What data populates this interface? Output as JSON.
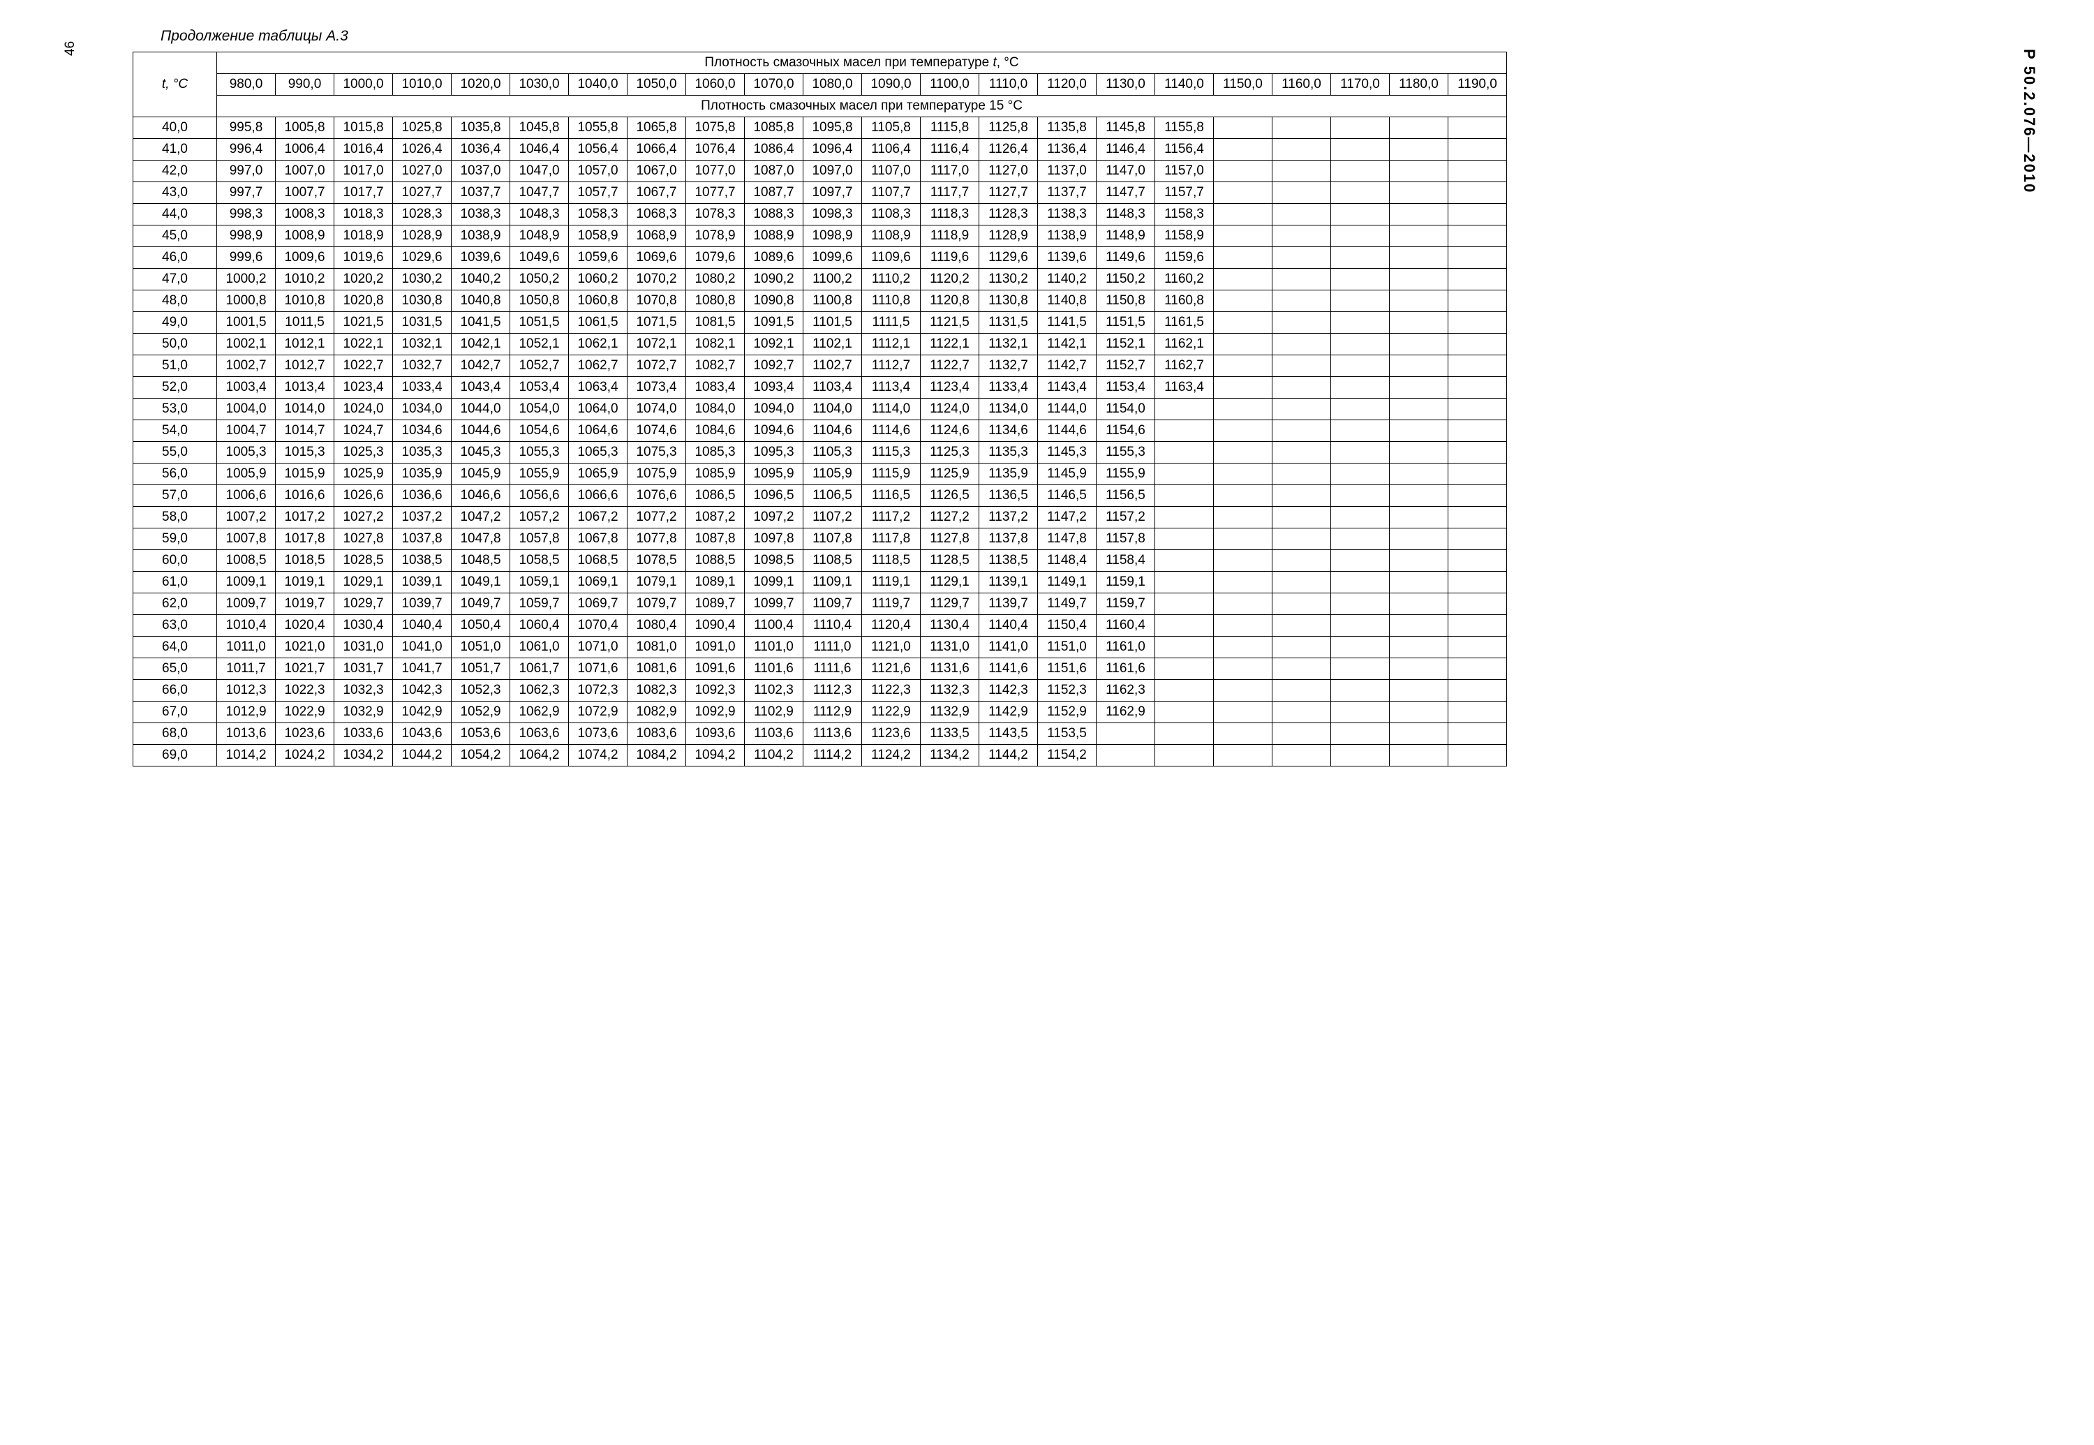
{
  "page_number": "46",
  "caption": "Продолжение таблицы А.3",
  "side_label": "Р 50.2.076—2010",
  "header": {
    "row_label": "t, °C",
    "span1_prefix": "Плотность смазочных масел при температуре ",
    "span1_var": "t",
    "span1_suffix": ", °C",
    "span2": "Плотность смазочных масел при температуре 15 °C",
    "cols": [
      "980,0",
      "990,0",
      "1000,0",
      "1010,0",
      "1020,0",
      "1030,0",
      "1040,0",
      "1050,0",
      "1060,0",
      "1070,0",
      "1080,0",
      "1090,0",
      "1100,0",
      "1110,0",
      "1120,0",
      "1130,0",
      "1140,0",
      "1150,0",
      "1160,0",
      "1170,0",
      "1180,0",
      "1190,0"
    ]
  },
  "rows": [
    {
      "t": "40,0",
      "v": [
        "995,8",
        "1005,8",
        "1015,8",
        "1025,8",
        "1035,8",
        "1045,8",
        "1055,8",
        "1065,8",
        "1075,8",
        "1085,8",
        "1095,8",
        "1105,8",
        "1115,8",
        "1125,8",
        "1135,8",
        "1145,8",
        "1155,8",
        "",
        "",
        "",
        "",
        ""
      ]
    },
    {
      "t": "41,0",
      "v": [
        "996,4",
        "1006,4",
        "1016,4",
        "1026,4",
        "1036,4",
        "1046,4",
        "1056,4",
        "1066,4",
        "1076,4",
        "1086,4",
        "1096,4",
        "1106,4",
        "1116,4",
        "1126,4",
        "1136,4",
        "1146,4",
        "1156,4",
        "",
        "",
        "",
        "",
        ""
      ]
    },
    {
      "t": "42,0",
      "v": [
        "997,0",
        "1007,0",
        "1017,0",
        "1027,0",
        "1037,0",
        "1047,0",
        "1057,0",
        "1067,0",
        "1077,0",
        "1087,0",
        "1097,0",
        "1107,0",
        "1117,0",
        "1127,0",
        "1137,0",
        "1147,0",
        "1157,0",
        "",
        "",
        "",
        "",
        ""
      ]
    },
    {
      "t": "43,0",
      "v": [
        "997,7",
        "1007,7",
        "1017,7",
        "1027,7",
        "1037,7",
        "1047,7",
        "1057,7",
        "1067,7",
        "1077,7",
        "1087,7",
        "1097,7",
        "1107,7",
        "1117,7",
        "1127,7",
        "1137,7",
        "1147,7",
        "1157,7",
        "",
        "",
        "",
        "",
        ""
      ]
    },
    {
      "t": "44,0",
      "v": [
        "998,3",
        "1008,3",
        "1018,3",
        "1028,3",
        "1038,3",
        "1048,3",
        "1058,3",
        "1068,3",
        "1078,3",
        "1088,3",
        "1098,3",
        "1108,3",
        "1118,3",
        "1128,3",
        "1138,3",
        "1148,3",
        "1158,3",
        "",
        "",
        "",
        "",
        ""
      ]
    },
    {
      "t": "45,0",
      "v": [
        "998,9",
        "1008,9",
        "1018,9",
        "1028,9",
        "1038,9",
        "1048,9",
        "1058,9",
        "1068,9",
        "1078,9",
        "1088,9",
        "1098,9",
        "1108,9",
        "1118,9",
        "1128,9",
        "1138,9",
        "1148,9",
        "1158,9",
        "",
        "",
        "",
        "",
        ""
      ]
    },
    {
      "t": "46,0",
      "v": [
        "999,6",
        "1009,6",
        "1019,6",
        "1029,6",
        "1039,6",
        "1049,6",
        "1059,6",
        "1069,6",
        "1079,6",
        "1089,6",
        "1099,6",
        "1109,6",
        "1119,6",
        "1129,6",
        "1139,6",
        "1149,6",
        "1159,6",
        "",
        "",
        "",
        "",
        ""
      ]
    },
    {
      "t": "47,0",
      "v": [
        "1000,2",
        "1010,2",
        "1020,2",
        "1030,2",
        "1040,2",
        "1050,2",
        "1060,2",
        "1070,2",
        "1080,2",
        "1090,2",
        "1100,2",
        "1110,2",
        "1120,2",
        "1130,2",
        "1140,2",
        "1150,2",
        "1160,2",
        "",
        "",
        "",
        "",
        ""
      ]
    },
    {
      "t": "48,0",
      "v": [
        "1000,8",
        "1010,8",
        "1020,8",
        "1030,8",
        "1040,8",
        "1050,8",
        "1060,8",
        "1070,8",
        "1080,8",
        "1090,8",
        "1100,8",
        "1110,8",
        "1120,8",
        "1130,8",
        "1140,8",
        "1150,8",
        "1160,8",
        "",
        "",
        "",
        "",
        ""
      ]
    },
    {
      "t": "49,0",
      "v": [
        "1001,5",
        "1011,5",
        "1021,5",
        "1031,5",
        "1041,5",
        "1051,5",
        "1061,5",
        "1071,5",
        "1081,5",
        "1091,5",
        "1101,5",
        "1111,5",
        "1121,5",
        "1131,5",
        "1141,5",
        "1151,5",
        "1161,5",
        "",
        "",
        "",
        "",
        ""
      ]
    },
    {
      "t": "50,0",
      "v": [
        "1002,1",
        "1012,1",
        "1022,1",
        "1032,1",
        "1042,1",
        "1052,1",
        "1062,1",
        "1072,1",
        "1082,1",
        "1092,1",
        "1102,1",
        "1112,1",
        "1122,1",
        "1132,1",
        "1142,1",
        "1152,1",
        "1162,1",
        "",
        "",
        "",
        "",
        ""
      ]
    },
    {
      "t": "51,0",
      "v": [
        "1002,7",
        "1012,7",
        "1022,7",
        "1032,7",
        "1042,7",
        "1052,7",
        "1062,7",
        "1072,7",
        "1082,7",
        "1092,7",
        "1102,7",
        "1112,7",
        "1122,7",
        "1132,7",
        "1142,7",
        "1152,7",
        "1162,7",
        "",
        "",
        "",
        "",
        ""
      ]
    },
    {
      "t": "52,0",
      "v": [
        "1003,4",
        "1013,4",
        "1023,4",
        "1033,4",
        "1043,4",
        "1053,4",
        "1063,4",
        "1073,4",
        "1083,4",
        "1093,4",
        "1103,4",
        "1113,4",
        "1123,4",
        "1133,4",
        "1143,4",
        "1153,4",
        "1163,4",
        "",
        "",
        "",
        "",
        ""
      ]
    },
    {
      "t": "53,0",
      "v": [
        "1004,0",
        "1014,0",
        "1024,0",
        "1034,0",
        "1044,0",
        "1054,0",
        "1064,0",
        "1074,0",
        "1084,0",
        "1094,0",
        "1104,0",
        "1114,0",
        "1124,0",
        "1134,0",
        "1144,0",
        "1154,0",
        "",
        "",
        "",
        "",
        "",
        ""
      ]
    },
    {
      "t": "54,0",
      "v": [
        "1004,7",
        "1014,7",
        "1024,7",
        "1034,6",
        "1044,6",
        "1054,6",
        "1064,6",
        "1074,6",
        "1084,6",
        "1094,6",
        "1104,6",
        "1114,6",
        "1124,6",
        "1134,6",
        "1144,6",
        "1154,6",
        "",
        "",
        "",
        "",
        "",
        ""
      ]
    },
    {
      "t": "55,0",
      "v": [
        "1005,3",
        "1015,3",
        "1025,3",
        "1035,3",
        "1045,3",
        "1055,3",
        "1065,3",
        "1075,3",
        "1085,3",
        "1095,3",
        "1105,3",
        "1115,3",
        "1125,3",
        "1135,3",
        "1145,3",
        "1155,3",
        "",
        "",
        "",
        "",
        "",
        ""
      ]
    },
    {
      "t": "56,0",
      "v": [
        "1005,9",
        "1015,9",
        "1025,9",
        "1035,9",
        "1045,9",
        "1055,9",
        "1065,9",
        "1075,9",
        "1085,9",
        "1095,9",
        "1105,9",
        "1115,9",
        "1125,9",
        "1135,9",
        "1145,9",
        "1155,9",
        "",
        "",
        "",
        "",
        "",
        ""
      ]
    },
    {
      "t": "57,0",
      "v": [
        "1006,6",
        "1016,6",
        "1026,6",
        "1036,6",
        "1046,6",
        "1056,6",
        "1066,6",
        "1076,6",
        "1086,5",
        "1096,5",
        "1106,5",
        "1116,5",
        "1126,5",
        "1136,5",
        "1146,5",
        "1156,5",
        "",
        "",
        "",
        "",
        "",
        ""
      ]
    },
    {
      "t": "58,0",
      "v": [
        "1007,2",
        "1017,2",
        "1027,2",
        "1037,2",
        "1047,2",
        "1057,2",
        "1067,2",
        "1077,2",
        "1087,2",
        "1097,2",
        "1107,2",
        "1117,2",
        "1127,2",
        "1137,2",
        "1147,2",
        "1157,2",
        "",
        "",
        "",
        "",
        "",
        ""
      ]
    },
    {
      "t": "59,0",
      "v": [
        "1007,8",
        "1017,8",
        "1027,8",
        "1037,8",
        "1047,8",
        "1057,8",
        "1067,8",
        "1077,8",
        "1087,8",
        "1097,8",
        "1107,8",
        "1117,8",
        "1127,8",
        "1137,8",
        "1147,8",
        "1157,8",
        "",
        "",
        "",
        "",
        "",
        ""
      ]
    },
    {
      "t": "60,0",
      "v": [
        "1008,5",
        "1018,5",
        "1028,5",
        "1038,5",
        "1048,5",
        "1058,5",
        "1068,5",
        "1078,5",
        "1088,5",
        "1098,5",
        "1108,5",
        "1118,5",
        "1128,5",
        "1138,5",
        "1148,4",
        "1158,4",
        "",
        "",
        "",
        "",
        "",
        ""
      ]
    },
    {
      "t": "61,0",
      "v": [
        "1009,1",
        "1019,1",
        "1029,1",
        "1039,1",
        "1049,1",
        "1059,1",
        "1069,1",
        "1079,1",
        "1089,1",
        "1099,1",
        "1109,1",
        "1119,1",
        "1129,1",
        "1139,1",
        "1149,1",
        "1159,1",
        "",
        "",
        "",
        "",
        "",
        ""
      ]
    },
    {
      "t": "62,0",
      "v": [
        "1009,7",
        "1019,7",
        "1029,7",
        "1039,7",
        "1049,7",
        "1059,7",
        "1069,7",
        "1079,7",
        "1089,7",
        "1099,7",
        "1109,7",
        "1119,7",
        "1129,7",
        "1139,7",
        "1149,7",
        "1159,7",
        "",
        "",
        "",
        "",
        "",
        ""
      ]
    },
    {
      "t": "63,0",
      "v": [
        "1010,4",
        "1020,4",
        "1030,4",
        "1040,4",
        "1050,4",
        "1060,4",
        "1070,4",
        "1080,4",
        "1090,4",
        "1100,4",
        "1110,4",
        "1120,4",
        "1130,4",
        "1140,4",
        "1150,4",
        "1160,4",
        "",
        "",
        "",
        "",
        "",
        ""
      ]
    },
    {
      "t": "64,0",
      "v": [
        "1011,0",
        "1021,0",
        "1031,0",
        "1041,0",
        "1051,0",
        "1061,0",
        "1071,0",
        "1081,0",
        "1091,0",
        "1101,0",
        "1111,0",
        "1121,0",
        "1131,0",
        "1141,0",
        "1151,0",
        "1161,0",
        "",
        "",
        "",
        "",
        "",
        ""
      ]
    },
    {
      "t": "65,0",
      "v": [
        "1011,7",
        "1021,7",
        "1031,7",
        "1041,7",
        "1051,7",
        "1061,7",
        "1071,6",
        "1081,6",
        "1091,6",
        "1101,6",
        "1111,6",
        "1121,6",
        "1131,6",
        "1141,6",
        "1151,6",
        "1161,6",
        "",
        "",
        "",
        "",
        "",
        ""
      ]
    },
    {
      "t": "66,0",
      "v": [
        "1012,3",
        "1022,3",
        "1032,3",
        "1042,3",
        "1052,3",
        "1062,3",
        "1072,3",
        "1082,3",
        "1092,3",
        "1102,3",
        "1112,3",
        "1122,3",
        "1132,3",
        "1142,3",
        "1152,3",
        "1162,3",
        "",
        "",
        "",
        "",
        "",
        ""
      ]
    },
    {
      "t": "67,0",
      "v": [
        "1012,9",
        "1022,9",
        "1032,9",
        "1042,9",
        "1052,9",
        "1062,9",
        "1072,9",
        "1082,9",
        "1092,9",
        "1102,9",
        "1112,9",
        "1122,9",
        "1132,9",
        "1142,9",
        "1152,9",
        "1162,9",
        "",
        "",
        "",
        "",
        "",
        ""
      ]
    },
    {
      "t": "68,0",
      "v": [
        "1013,6",
        "1023,6",
        "1033,6",
        "1043,6",
        "1053,6",
        "1063,6",
        "1073,6",
        "1083,6",
        "1093,6",
        "1103,6",
        "1113,6",
        "1123,6",
        "1133,5",
        "1143,5",
        "1153,5",
        "",
        "",
        "",
        "",
        "",
        "",
        ""
      ]
    },
    {
      "t": "69,0",
      "v": [
        "1014,2",
        "1024,2",
        "1034,2",
        "1044,2",
        "1054,2",
        "1064,2",
        "1074,2",
        "1084,2",
        "1094,2",
        "1104,2",
        "1114,2",
        "1124,2",
        "1134,2",
        "1144,2",
        "1154,2",
        "",
        "",
        "",
        "",
        "",
        "",
        ""
      ]
    }
  ]
}
